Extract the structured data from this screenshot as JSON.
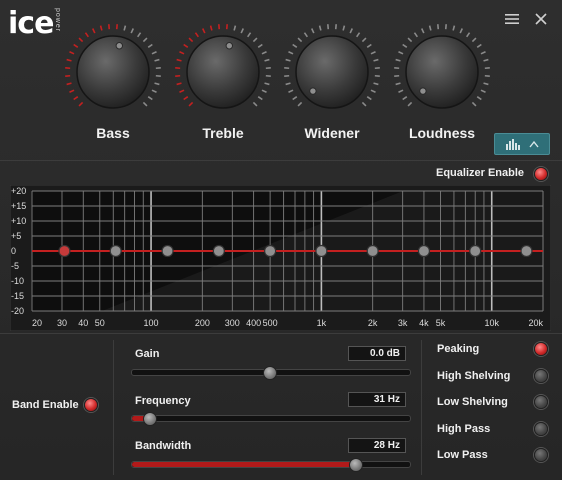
{
  "header": {
    "logo": "ice",
    "logo_sub": "power",
    "menu_icon": "hamburger-menu-icon",
    "close_icon": "close-icon"
  },
  "knobs": [
    {
      "label": "Bass",
      "level": 0.55
    },
    {
      "label": "Treble",
      "level": 0.55
    },
    {
      "label": "Widener",
      "level": 0
    },
    {
      "label": "Loudness",
      "level": 0
    }
  ],
  "equalizer_enable": {
    "label": "Equalizer Enable",
    "on": true
  },
  "graph": {
    "y_ticks": [
      "+20",
      "+15",
      "+10",
      "+5",
      "0",
      "-5",
      "-10",
      "-15",
      "-20"
    ],
    "x_ticks": [
      "20",
      "30",
      "40",
      "50",
      "100",
      "200",
      "300",
      "400",
      "500",
      "1k",
      "2k",
      "3k",
      "4k",
      "5k",
      "10k",
      "20k"
    ],
    "band_points": [
      31,
      62,
      125,
      250,
      500,
      1000,
      2000,
      4000,
      8000,
      16000
    ],
    "selected_band": 0
  },
  "band": {
    "enable_label": "Band Enable",
    "enabled": true,
    "gain_label": "Gain",
    "gain_value": "0.0 dB",
    "gain_level": 0.5,
    "frequency_label": "Frequency",
    "frequency_value": "31 Hz",
    "frequency_level": 0.07,
    "bandwidth_label": "Bandwidth",
    "bandwidth_value": "28 Hz",
    "bandwidth_level": 0.81
  },
  "filter_types": [
    {
      "label": "Peaking",
      "on": true
    },
    {
      "label": "High Shelving",
      "on": false
    },
    {
      "label": "Low Shelving",
      "on": false
    },
    {
      "label": "High Pass",
      "on": false
    },
    {
      "label": "Low Pass",
      "on": false
    }
  ],
  "colors": {
    "accent": "#c42020",
    "eq_button": "#2f6f78"
  }
}
